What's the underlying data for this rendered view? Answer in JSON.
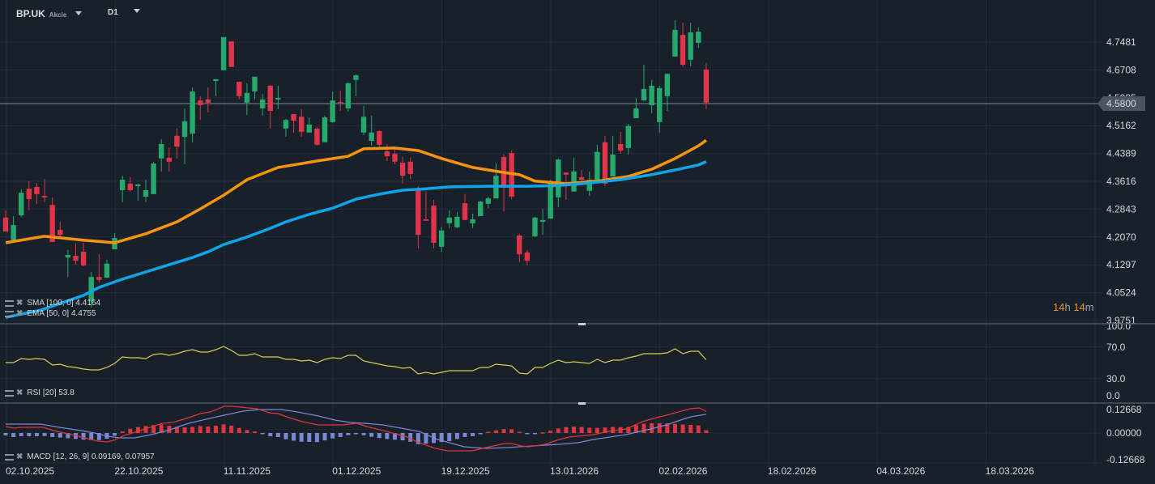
{
  "header": {
    "symbol": "BP.UK",
    "type": "Akcie",
    "timeframe": "D1"
  },
  "indicators": {
    "sma": "SMA [100, 0] 4.4164",
    "ema": "EMA [50, 0] 4.4755",
    "rsi": "RSI [20]  53.8",
    "macd": "MACD [12, 26, 9] 0.09169,  0.07957"
  },
  "timer": {
    "hours": "14",
    "h": "h",
    "minutes": "14",
    "m": "m"
  },
  "colors": {
    "bg": "#18202a",
    "up": "#26a96c",
    "down": "#e0344a",
    "ema": "#f7930e",
    "sma": "#0ea5e9",
    "rsi": "#d6cc5a",
    "macd": "#e0343e",
    "signal": "#7a87d6"
  },
  "current_price": "4.5800",
  "chart_data": {
    "type": "candlestick",
    "price_axis": {
      "ticks": [
        "4.7481",
        "4.6708",
        "4.5935",
        "4.5162",
        "4.4389",
        "4.3616",
        "4.2843",
        "4.2070",
        "4.1297",
        "4.0524",
        "3.9751"
      ]
    },
    "rsi_axis": {
      "ticks": [
        "100.0",
        "70.0",
        "30.0",
        "0.0"
      ]
    },
    "macd_axis": {
      "ticks": [
        "0.12668",
        "0.00000",
        "-0.12668"
      ]
    },
    "date_labels": [
      "02.10.2025",
      "22.10.2025",
      "11.11.2025",
      "01.12.2025",
      "19.12.2025",
      "13.01.2026",
      "02.02.2026",
      "18.02.2026",
      "04.03.2026",
      "18.03.2026"
    ],
    "ohlc": [
      [
        4.261,
        4.281,
        4.222,
        4.222
      ],
      [
        4.198,
        4.265,
        4.198,
        4.24
      ],
      [
        4.267,
        4.339,
        4.263,
        4.33
      ],
      [
        4.341,
        4.362,
        4.281,
        4.312
      ],
      [
        4.346,
        4.357,
        4.299,
        4.326
      ],
      [
        4.321,
        4.368,
        4.303,
        4.317
      ],
      [
        4.296,
        4.317,
        4.193,
        4.193
      ],
      [
        4.227,
        4.249,
        4.207,
        4.213
      ],
      [
        4.15,
        4.171,
        4.096,
        4.157
      ],
      [
        4.155,
        4.189,
        4.13,
        4.141
      ],
      [
        4.166,
        4.191,
        4.126,
        4.128
      ],
      [
        4.029,
        4.11,
        4.011,
        4.096
      ],
      [
        4.096,
        4.159,
        4.081,
        4.088
      ],
      [
        4.094,
        4.144,
        4.094,
        4.133
      ],
      [
        4.173,
        4.218,
        4.173,
        4.204
      ],
      [
        4.337,
        4.377,
        4.303,
        4.366
      ],
      [
        4.355,
        4.373,
        4.333,
        4.337
      ],
      [
        4.348,
        4.355,
        4.308,
        4.353
      ],
      [
        4.319,
        4.366,
        4.303,
        4.337
      ],
      [
        4.326,
        4.416,
        4.326,
        4.411
      ],
      [
        4.425,
        4.479,
        4.389,
        4.465
      ],
      [
        4.427,
        4.456,
        4.389,
        4.416
      ],
      [
        4.488,
        4.508,
        4.425,
        4.458
      ],
      [
        4.485,
        4.564,
        4.409,
        4.528
      ],
      [
        4.494,
        4.622,
        4.47,
        4.611
      ],
      [
        4.586,
        4.598,
        4.532,
        4.573
      ],
      [
        4.589,
        4.622,
        4.553,
        4.58
      ],
      [
        4.64,
        4.645,
        4.598,
        4.645
      ],
      [
        4.67,
        4.762,
        4.67,
        4.762
      ],
      [
        4.75,
        4.75,
        4.679,
        4.679
      ],
      [
        4.638,
        4.638,
        4.589,
        4.598
      ],
      [
        4.58,
        4.634,
        4.546,
        4.607
      ],
      [
        4.611,
        4.652,
        4.589,
        4.652
      ],
      [
        4.564,
        4.604,
        4.544,
        4.589
      ],
      [
        4.627,
        4.629,
        4.508,
        4.557
      ],
      [
        4.589,
        4.627,
        4.562,
        4.593
      ],
      [
        4.508,
        4.535,
        4.485,
        4.532
      ],
      [
        4.548,
        4.548,
        4.497,
        4.53
      ],
      [
        4.541,
        4.562,
        4.485,
        4.499
      ],
      [
        4.497,
        4.539,
        4.497,
        4.519
      ],
      [
        4.508,
        4.512,
        4.461,
        4.463
      ],
      [
        4.47,
        4.544,
        4.47,
        4.539
      ],
      [
        4.526,
        4.611,
        4.524,
        4.586
      ],
      [
        4.582,
        4.613,
        4.557,
        4.58
      ],
      [
        4.564,
        4.636,
        4.555,
        4.634
      ],
      [
        4.643,
        4.658,
        4.598,
        4.656
      ],
      [
        4.497,
        4.571,
        4.49,
        4.541
      ],
      [
        4.474,
        4.544,
        4.461,
        4.497
      ],
      [
        4.501,
        4.503,
        4.449,
        4.463
      ],
      [
        4.445,
        4.465,
        4.418,
        4.431
      ],
      [
        4.438,
        4.449,
        4.409,
        4.416
      ],
      [
        4.413,
        4.429,
        4.355,
        4.377
      ],
      [
        4.416,
        4.427,
        4.368,
        4.382
      ],
      [
        4.341,
        4.348,
        4.175,
        4.213
      ],
      [
        4.256,
        4.333,
        4.252,
        4.252
      ],
      [
        4.294,
        4.31,
        4.175,
        4.191
      ],
      [
        4.18,
        4.234,
        4.166,
        4.225
      ],
      [
        4.245,
        4.281,
        4.231,
        4.261
      ],
      [
        4.234,
        4.276,
        4.231,
        4.263
      ],
      [
        4.301,
        4.326,
        4.254,
        4.254
      ],
      [
        4.245,
        4.272,
        4.231,
        4.256
      ],
      [
        4.265,
        4.308,
        4.265,
        4.305
      ],
      [
        4.299,
        4.319,
        4.287,
        4.314
      ],
      [
        4.314,
        4.411,
        4.314,
        4.377
      ],
      [
        4.429,
        4.436,
        4.278,
        4.344
      ],
      [
        4.44,
        4.447,
        4.312,
        4.319
      ],
      [
        4.211,
        4.216,
        4.137,
        4.159
      ],
      [
        4.164,
        4.171,
        4.128,
        4.141
      ],
      [
        4.209,
        4.263,
        4.207,
        4.261
      ],
      [
        4.249,
        4.285,
        4.213,
        4.254
      ],
      [
        4.258,
        4.366,
        4.258,
        4.359
      ],
      [
        4.317,
        4.425,
        4.29,
        4.422
      ],
      [
        4.386,
        4.386,
        4.31,
        4.38
      ],
      [
        4.333,
        4.427,
        4.333,
        4.389
      ],
      [
        4.373,
        4.393,
        4.35,
        4.366
      ],
      [
        4.335,
        4.389,
        4.321,
        4.366
      ],
      [
        4.366,
        4.463,
        4.366,
        4.443
      ],
      [
        4.47,
        4.488,
        4.348,
        4.355
      ],
      [
        4.375,
        4.488,
        4.375,
        4.436
      ],
      [
        4.465,
        4.499,
        4.438,
        4.447
      ],
      [
        4.454,
        4.521,
        4.436,
        4.515
      ],
      [
        4.537,
        4.593,
        4.537,
        4.564
      ],
      [
        4.586,
        4.685,
        4.586,
        4.618
      ],
      [
        4.573,
        4.643,
        4.55,
        4.627
      ],
      [
        4.526,
        4.627,
        4.497,
        4.62
      ],
      [
        4.598,
        4.66,
        4.557,
        4.66
      ],
      [
        4.708,
        4.809,
        4.708,
        4.782
      ],
      [
        4.768,
        4.802,
        4.679,
        4.685
      ],
      [
        4.699,
        4.802,
        4.681,
        4.775
      ],
      [
        4.746,
        4.789,
        4.732,
        4.777
      ],
      [
        4.672,
        4.69,
        4.562,
        4.58
      ]
    ],
    "ema50": [
      [
        0,
        4.191
      ],
      [
        5,
        4.209
      ],
      [
        10,
        4.198
      ],
      [
        14,
        4.191
      ],
      [
        18,
        4.216
      ],
      [
        22,
        4.249
      ],
      [
        25,
        4.285
      ],
      [
        28,
        4.323
      ],
      [
        31,
        4.366
      ],
      [
        35,
        4.4
      ],
      [
        40,
        4.418
      ],
      [
        44,
        4.431
      ],
      [
        46,
        4.452
      ],
      [
        50,
        4.454
      ],
      [
        53,
        4.447
      ],
      [
        56,
        4.425
      ],
      [
        60,
        4.4
      ],
      [
        64,
        4.386
      ],
      [
        66,
        4.38
      ],
      [
        68,
        4.362
      ],
      [
        72,
        4.355
      ],
      [
        76,
        4.362
      ],
      [
        80,
        4.375
      ],
      [
        83,
        4.395
      ],
      [
        86,
        4.425
      ],
      [
        89,
        4.46
      ],
      [
        90,
        4.4755
      ]
    ],
    "sma100": [
      [
        0,
        3.984
      ],
      [
        4.5,
        4.004
      ],
      [
        10,
        4.045
      ],
      [
        12,
        4.067
      ],
      [
        15,
        4.09
      ],
      [
        18,
        4.11
      ],
      [
        21,
        4.13
      ],
      [
        24,
        4.15
      ],
      [
        26,
        4.166
      ],
      [
        28,
        4.186
      ],
      [
        31,
        4.207
      ],
      [
        34,
        4.231
      ],
      [
        36,
        4.249
      ],
      [
        39,
        4.27
      ],
      [
        42,
        4.287
      ],
      [
        45,
        4.312
      ],
      [
        48,
        4.326
      ],
      [
        51,
        4.337
      ],
      [
        54,
        4.341
      ],
      [
        57,
        4.346
      ],
      [
        62,
        4.348
      ],
      [
        67,
        4.348
      ],
      [
        71,
        4.35
      ],
      [
        75,
        4.357
      ],
      [
        79,
        4.366
      ],
      [
        83,
        4.38
      ],
      [
        86,
        4.393
      ],
      [
        89,
        4.407
      ],
      [
        90,
        4.4164
      ]
    ],
    "rsi": [
      50.3,
      50.3,
      55.4,
      54.4,
      55.4,
      54.4,
      47.2,
      48.2,
      45.1,
      44.1,
      42.1,
      41.0,
      41.0,
      44.1,
      49.2,
      57.4,
      56.4,
      56.4,
      55.4,
      60.5,
      61.5,
      59.5,
      61.5,
      64.6,
      66.7,
      63.6,
      63.6,
      66.7,
      70.8,
      65.6,
      59.5,
      59.5,
      61.5,
      57.4,
      57.4,
      57.4,
      54.4,
      54.4,
      52.3,
      53.3,
      50.3,
      54.4,
      56.4,
      55.4,
      59.5,
      59.5,
      52.3,
      50.3,
      48.2,
      46.2,
      45.1,
      43.1,
      44.1,
      35.9,
      37.9,
      35.9,
      37.9,
      40.0,
      40.0,
      40.0,
      40.0,
      44.1,
      44.1,
      48.2,
      47.2,
      46.2,
      36.9,
      35.9,
      44.1,
      44.1,
      49.2,
      53.3,
      50.3,
      51.3,
      50.3,
      49.2,
      54.4,
      50.3,
      53.3,
      53.3,
      56.4,
      58.5,
      61.5,
      61.5,
      61.5,
      62.6,
      67.7,
      61.5,
      64.6,
      64.6,
      53.8
    ],
    "macd": [
      [
        0,
        0.0274
      ],
      [
        1,
        0.0205
      ],
      [
        2,
        0.024
      ],
      [
        4.8,
        0.024
      ],
      [
        6.2,
        0.0103
      ],
      [
        8.9,
        -0.0103
      ],
      [
        11.8,
        -0.0342
      ],
      [
        13.1,
        -0.0377
      ],
      [
        14.2,
        -0.0274
      ],
      [
        15.2,
        -0.0103
      ],
      [
        17.3,
        0.0103
      ],
      [
        20.1,
        0.0411
      ],
      [
        21.4,
        0.0445
      ],
      [
        22.9,
        0.0582
      ],
      [
        25,
        0.0822
      ],
      [
        26.3,
        0.089
      ],
      [
        28.1,
        0.113
      ],
      [
        29.1,
        0.113
      ],
      [
        31.2,
        0.1061
      ],
      [
        32.3,
        0.1027
      ],
      [
        33.9,
        0.0856
      ],
      [
        35,
        0.0822
      ],
      [
        36.4,
        0.0651
      ],
      [
        38.1,
        0.0479
      ],
      [
        40.1,
        0.0342
      ],
      [
        43.3,
        0.0342
      ],
      [
        45.1,
        0.0411
      ],
      [
        46.4,
        0.0274
      ],
      [
        48.5,
        0.0103
      ],
      [
        51.6,
        -0.0171
      ],
      [
        53.1,
        -0.0411
      ],
      [
        55.2,
        -0.0651
      ],
      [
        56.8,
        -0.0753
      ],
      [
        59.9,
        -0.0753
      ],
      [
        61.7,
        -0.0616
      ],
      [
        64.1,
        -0.0445
      ],
      [
        65,
        -0.0445
      ],
      [
        66.2,
        -0.0548
      ],
      [
        67.2,
        -0.0582
      ],
      [
        69.3,
        -0.0479
      ],
      [
        71.1,
        -0.0274
      ],
      [
        72.4,
        -0.0171
      ],
      [
        74.5,
        -0.0103
      ],
      [
        75.5,
        -0.0068
      ],
      [
        78,
        0.0103
      ],
      [
        79.7,
        0.0171
      ],
      [
        81.8,
        0.0479
      ],
      [
        83.2,
        0.0616
      ],
      [
        84.9,
        0.0753
      ],
      [
        86.4,
        0.089
      ],
      [
        88,
        0.1027
      ],
      [
        89.1,
        0.1061
      ],
      [
        90,
        0.09169
      ]
    ],
    "signal": [
      [
        0,
        0.0377
      ],
      [
        4.5,
        0.0377
      ],
      [
        6.9,
        0.024
      ],
      [
        9.7,
        0.0103
      ],
      [
        11.4,
        0.0
      ],
      [
        13.1,
        -0.0137
      ],
      [
        14.6,
        -0.0205
      ],
      [
        16.6,
        -0.0205
      ],
      [
        18.7,
        -0.0068
      ],
      [
        20.8,
        0.0103
      ],
      [
        23.5,
        0.0411
      ],
      [
        27.1,
        0.0685
      ],
      [
        30.5,
        0.0924
      ],
      [
        32.6,
        0.0993
      ],
      [
        35.4,
        0.0993
      ],
      [
        37.5,
        0.089
      ],
      [
        40.2,
        0.0719
      ],
      [
        42.3,
        0.0548
      ],
      [
        44.3,
        0.0445
      ],
      [
        46.1,
        0.0411
      ],
      [
        48.5,
        0.0342
      ],
      [
        53.1,
        0.0068
      ],
      [
        55.5,
        -0.0274
      ],
      [
        58.9,
        -0.0582
      ],
      [
        61.7,
        -0.0651
      ],
      [
        64.5,
        -0.0616
      ],
      [
        67.6,
        -0.0548
      ],
      [
        71.1,
        -0.0479
      ],
      [
        73.5,
        -0.0411
      ],
      [
        75.5,
        -0.0274
      ],
      [
        79.7,
        -0.0068
      ],
      [
        83.3,
        0.0205
      ],
      [
        84.9,
        0.0342
      ],
      [
        86.7,
        0.0548
      ],
      [
        88,
        0.0685
      ],
      [
        90,
        0.07957
      ]
    ]
  }
}
